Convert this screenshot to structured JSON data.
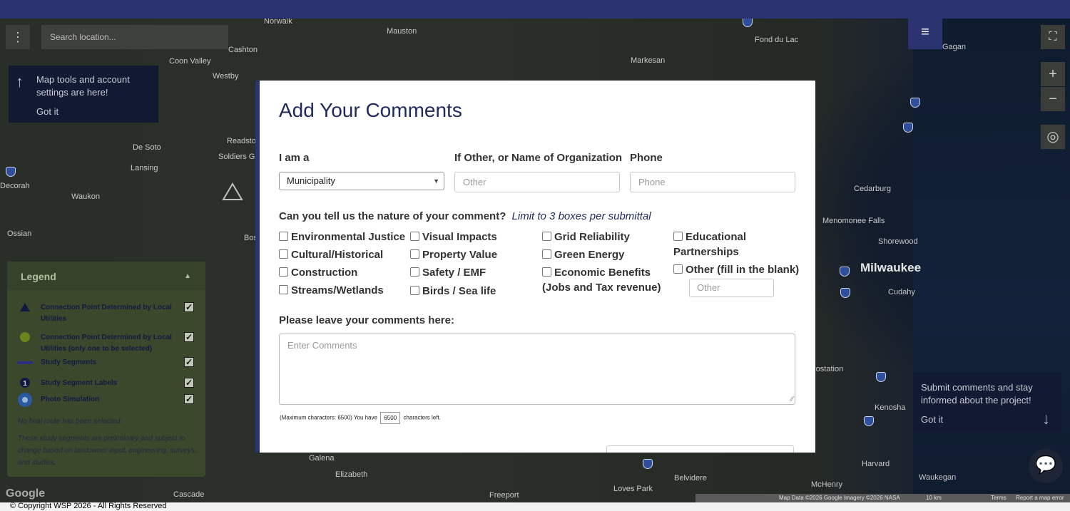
{
  "map": {
    "labels": [
      {
        "text": "Norwalk"
      },
      {
        "text": "Mauston"
      },
      {
        "text": "Fond du Lac"
      },
      {
        "text": "Gagan"
      },
      {
        "text": "Cashton"
      },
      {
        "text": "Markesan"
      },
      {
        "text": "Coon Valley"
      },
      {
        "text": "Westby"
      },
      {
        "text": "De Soto"
      },
      {
        "text": "Readstown"
      },
      {
        "text": "Soldiers Grove"
      },
      {
        "text": "Lansing"
      },
      {
        "text": "Decorah"
      },
      {
        "text": "Waukon"
      },
      {
        "text": "Ossian"
      },
      {
        "text": "Bos"
      },
      {
        "text": "Cedarburg"
      },
      {
        "text": "Menomonee Falls"
      },
      {
        "text": "Shorewood"
      },
      {
        "text": "Milwaukee"
      },
      {
        "text": "Cudahy"
      },
      {
        "text": "Kenosha"
      },
      {
        "text": "Galena"
      },
      {
        "text": "Elizabeth"
      },
      {
        "text": "Freeport"
      },
      {
        "text": "Loves Park"
      },
      {
        "text": "Belvidere"
      },
      {
        "text": "McHenry"
      },
      {
        "text": "Harvard"
      },
      {
        "text": "Waukegan"
      },
      {
        "text": "Cascade"
      },
      {
        "text": "rostation"
      }
    ],
    "search_placeholder": "Search location...",
    "menu_dots": "⋮",
    "hamburger": "≡",
    "fullscreen_icon": "⛶",
    "zoom_in": "+",
    "zoom_out": "−",
    "locate_icon": "◎"
  },
  "tips": {
    "tools": {
      "text": "Map tools and account settings are here!",
      "got_it": "Got it",
      "arrow": "↑"
    },
    "submit": {
      "text": "Submit comments and stay informed about the project!",
      "got_it": "Got it",
      "arrow": "↓"
    }
  },
  "legend": {
    "title": "Legend",
    "caret": "▲",
    "items": [
      {
        "label": "Connection Point Determined by Local Utilities",
        "checked": "✓"
      },
      {
        "label": "Connection Point Determined by Local Utilities (only one to be selected)",
        "checked": "✓"
      },
      {
        "label": "Study Segments",
        "checked": "✓"
      },
      {
        "label": "Study Segment Labels",
        "checked": "✓"
      },
      {
        "label": "Photo Simulation",
        "checked": "✓"
      }
    ],
    "note1": "No final route has been selected.",
    "note2": "These study segments are preliminary and subject to change based on landowner input, engineering, surveys, and studies."
  },
  "modal": {
    "title": "Add Your Comments",
    "iam_label": "I am a",
    "iam_value": "Municipality",
    "org_label": "If Other, or Name of Organization",
    "org_placeholder": "Other",
    "phone_label": "Phone",
    "phone_placeholder": "Phone",
    "question": "Can you tell us the nature of your comment?",
    "question_hint": "Limit to 3 boxes per submittal",
    "checkboxes": [
      "Environmental Justice",
      "Cultural/Historical",
      "Construction",
      "Streams/Wetlands",
      "Visual Impacts",
      "Property Value",
      "Safety / EMF",
      "Birds / Sea life",
      "Grid Reliability",
      "Green Energy",
      "Economic Benefits (Jobs and Tax revenue)",
      "Educational Partnerships",
      "Other (fill in the blank)"
    ],
    "other_placeholder": "Other",
    "comments_label": "Please leave your comments here:",
    "comments_placeholder": "Enter Comments",
    "chars_prefix": "(Maximum characters: 6500) You have",
    "chars_count": "6500",
    "chars_suffix": "characters left."
  },
  "attribution": {
    "data": "Map Data ©2026 Google Imagery ©2026 NASA",
    "scale": "10 km",
    "terms": "Terms",
    "report": "Report a map error"
  },
  "google": "Google",
  "footer": "© Copyright WSP 2026 - All Rights Reserved",
  "chat_icon": "💬"
}
